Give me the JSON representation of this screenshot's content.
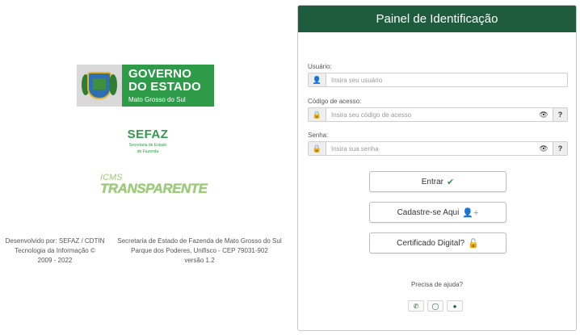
{
  "branding": {
    "gov_line1": "GOVERNO",
    "gov_line2": "DO ESTADO",
    "gov_line3": "Mato Grosso do Sul",
    "sefaz_title": "SEFAZ",
    "sefaz_sub1": "Secretaria de Estado",
    "sefaz_sub2": "de Fazenda",
    "icms_line1": "ICMS",
    "icms_line2": "TRANSPARENTE",
    "brand_green": "#2e9b49"
  },
  "footer": {
    "left": [
      "Desenvolvido por: SEFAZ / CDTIN",
      "Tecnologia da Informação ©",
      "2009 - 2022"
    ],
    "right": [
      "Secretaria de Estado de Fazenda de Mato Grosso do Sul",
      "Parque dos Poderes, Unifisco - CEP 79031-902",
      "versão 1.2"
    ]
  },
  "panel": {
    "title": "Painel de Identificação",
    "header_color": "#1f5b3d",
    "usuario_label": "Usuário:",
    "usuario_placeholder": "Insira seu usuário",
    "codigo_label": "Código de acesso:",
    "codigo_placeholder": "Insira seu código de acesso",
    "senha_label": "Senha:",
    "senha_placeholder": "Insira sua senha",
    "help_mark": "?",
    "icons": {
      "user": "user-icon",
      "lock": "lock-icon",
      "eye": "eye-slash-icon"
    }
  },
  "buttons": {
    "entrar": "Entrar",
    "cadastre": "Cadastre-se Aqui",
    "certificado": "Certificado Digital?"
  },
  "help": {
    "text": "Precisa de ajuda?",
    "icons": [
      "phone-icon",
      "whatsapp-icon",
      "chat-icon"
    ]
  }
}
